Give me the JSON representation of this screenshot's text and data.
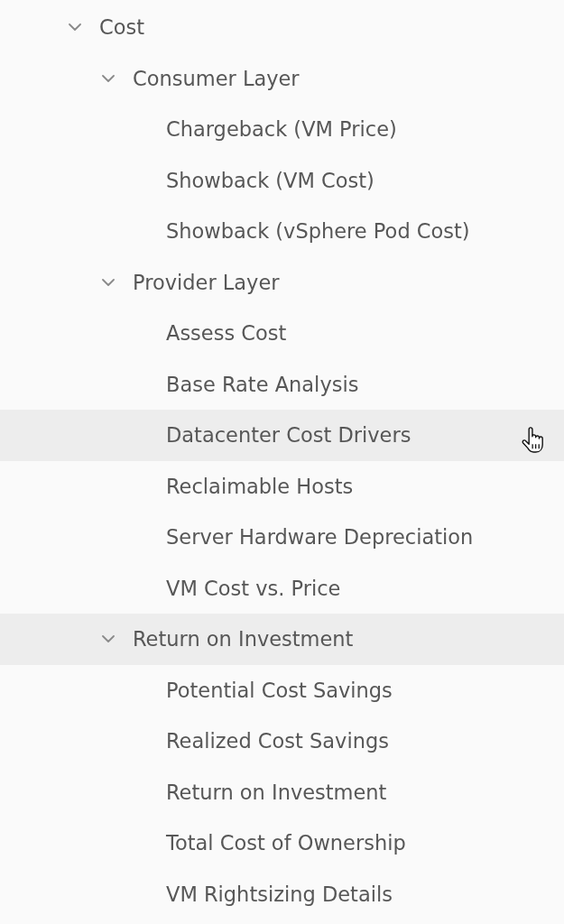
{
  "tree": [
    {
      "label": "Cost",
      "expanded": true,
      "selected": false,
      "hovered": false,
      "children": [
        {
          "label": "Consumer Layer",
          "expanded": true,
          "selected": false,
          "hovered": false,
          "children": [
            {
              "label": "Chargeback (VM Price)",
              "selected": false,
              "hovered": false
            },
            {
              "label": "Showback (VM Cost)",
              "selected": false,
              "hovered": false
            },
            {
              "label": "Showback (vSphere Pod Cost)",
              "selected": false,
              "hovered": false
            }
          ]
        },
        {
          "label": "Provider Layer",
          "expanded": true,
          "selected": false,
          "hovered": false,
          "children": [
            {
              "label": "Assess Cost",
              "selected": false,
              "hovered": false
            },
            {
              "label": "Base Rate Analysis",
              "selected": false,
              "hovered": false
            },
            {
              "label": "Datacenter Cost Drivers",
              "selected": false,
              "hovered": true
            },
            {
              "label": "Reclaimable Hosts",
              "selected": false,
              "hovered": false
            },
            {
              "label": "Server Hardware Depreciation",
              "selected": false,
              "hovered": false
            },
            {
              "label": "VM Cost vs. Price",
              "selected": false,
              "hovered": false
            }
          ]
        },
        {
          "label": "Return on Investment",
          "expanded": true,
          "selected": true,
          "hovered": false,
          "children": [
            {
              "label": "Potential Cost Savings",
              "selected": false,
              "hovered": false
            },
            {
              "label": "Realized Cost Savings",
              "selected": false,
              "hovered": false
            },
            {
              "label": "Return on Investment",
              "selected": false,
              "hovered": false
            },
            {
              "label": "Total Cost of Ownership",
              "selected": false,
              "hovered": false
            },
            {
              "label": "VM Rightsizing Details",
              "selected": false,
              "hovered": false
            }
          ]
        }
      ]
    }
  ]
}
